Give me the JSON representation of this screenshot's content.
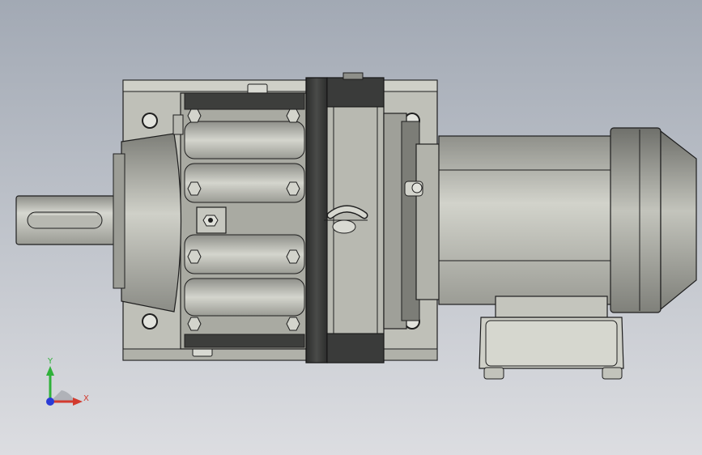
{
  "viewport": {
    "background_top": "#a2a9b4",
    "background_bottom": "#dcdde1"
  },
  "model": {
    "parts": [
      "output-shaft",
      "gearbox-housing",
      "flange-ring",
      "motor-body",
      "fan-cover",
      "terminal-box",
      "lifting-eye",
      "grease-nipple"
    ],
    "colors": {
      "housing": "#bfc0b8",
      "casting": "#a9aaa2",
      "dark_ring": "#3a3b3a",
      "motor": "#c4c5bd",
      "edge": "#1e1e1e"
    }
  },
  "triad": {
    "y_label": "Y",
    "x_label": "X",
    "y_color": "#2fb13a",
    "x_color": "#d23a2e",
    "z_color": "#2a3bd6"
  }
}
